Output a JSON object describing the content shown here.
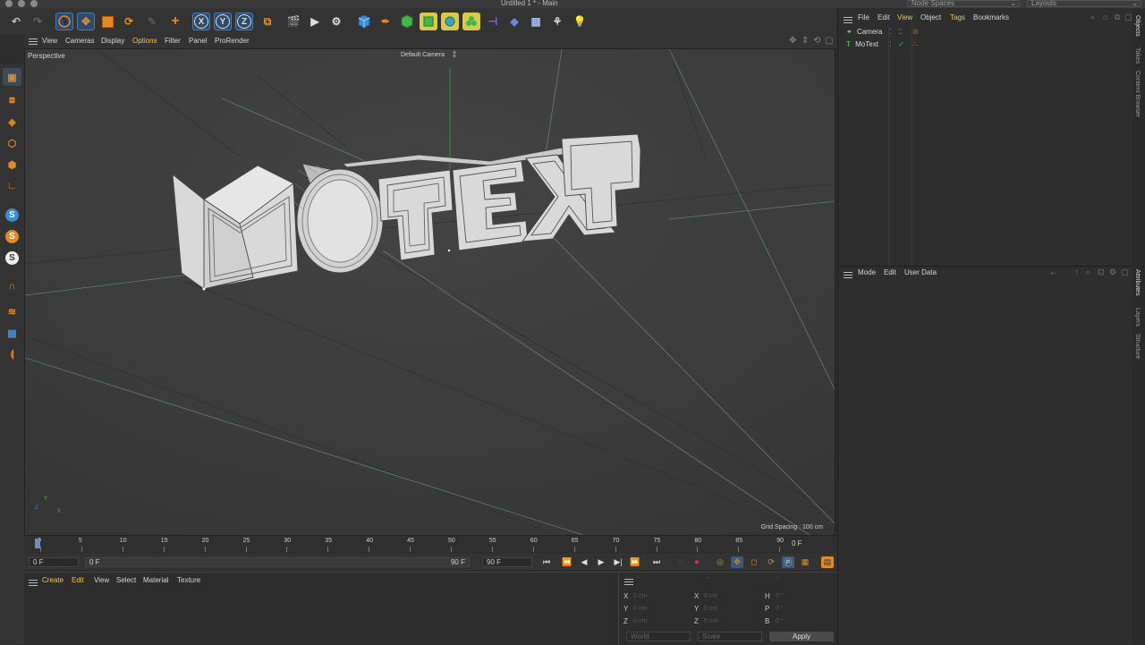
{
  "window": {
    "title": "Untitled 1 * - Main",
    "node_spaces_label": "Node Spaces",
    "layouts_label": "Layouts"
  },
  "toolbar": {
    "x_axis": "X",
    "y_axis": "Y",
    "z_axis": "Z"
  },
  "viewport_menu": {
    "items": [
      "View",
      "Cameras",
      "Display",
      "Options",
      "Filter",
      "Panel",
      "ProRender"
    ],
    "view_name": "Perspective",
    "camera_name": "Default Camera",
    "grid_spacing": "Grid Spacing : 100 cm",
    "axis_labels": [
      "Y",
      "Z",
      "X"
    ]
  },
  "scene": {
    "letters": [
      "M",
      "O",
      "T",
      "E",
      "X",
      "T"
    ]
  },
  "timeline": {
    "ticks": [
      "0",
      "5",
      "10",
      "15",
      "20",
      "25",
      "30",
      "35",
      "40",
      "45",
      "50",
      "55",
      "60",
      "65",
      "70",
      "75",
      "80",
      "85",
      "90"
    ],
    "current_frame": "0 F"
  },
  "playback": {
    "start_field": "0 F",
    "range_start": "0 F",
    "range_end": "90 F",
    "end_field": "90 F"
  },
  "material_manager": {
    "menu": [
      "Create",
      "Edit",
      "View",
      "Select",
      "Material",
      "Texture"
    ]
  },
  "coordinates": {
    "col1": [
      {
        "axis": "X",
        "value": "0 cm"
      },
      {
        "axis": "Y",
        "value": "0 cm"
      },
      {
        "axis": "Z",
        "value": "0 cm"
      }
    ],
    "col2": [
      {
        "axis": "X",
        "value": "0 cm"
      },
      {
        "axis": "Y",
        "value": "0 cm"
      },
      {
        "axis": "Z",
        "value": "0 cm"
      }
    ],
    "col3": [
      {
        "axis": "H",
        "value": "0 °"
      },
      {
        "axis": "P",
        "value": "0 °"
      },
      {
        "axis": "B",
        "value": "0 °"
      }
    ],
    "mode_world": "World",
    "mode_scale": "Scale",
    "apply": "Apply",
    "header_dashes": [
      "--",
      "--",
      "--"
    ]
  },
  "object_manager": {
    "menu": [
      "File",
      "Edit",
      "View",
      "Object",
      "Tags",
      "Bookmarks"
    ],
    "objects": [
      "Camera",
      "MoText"
    ]
  },
  "attribute_manager": {
    "menu": [
      "Mode",
      "Edit",
      "User Data"
    ]
  },
  "side_tabs": {
    "top": [
      "Objects",
      "Takes",
      "Content Browser"
    ],
    "bottom": [
      "Attributes",
      "Layers",
      "Structure"
    ]
  },
  "colors": {
    "accent_blue": "#4a7cb0",
    "active_menu": "#f2c744",
    "selection_yellow": "#e0d36a",
    "scene_bg": "#3a3a3a"
  }
}
